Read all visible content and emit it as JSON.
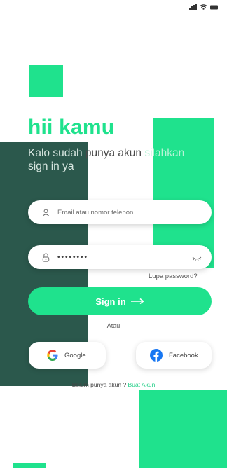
{
  "status_bar": {
    "icons": [
      "signal-icon",
      "wifi-icon",
      "battery-icon"
    ]
  },
  "greeting": "hii kamu",
  "subtitle": {
    "part1": "Kalo sudah ",
    "part2": "punya akun ",
    "part3": "silahkan",
    "line2": "sign in ya"
  },
  "email": {
    "placeholder": "Email atau nomor telepon",
    "value": "",
    "icon": "user-icon"
  },
  "password": {
    "masked": "••••••••",
    "icon": "lock-icon",
    "toggle_icon": "eye-closed-icon"
  },
  "forgot_label": "Lupa password?",
  "signin_label": "Sign in",
  "divider_label": "Atau",
  "social": {
    "google_label": "Google",
    "facebook_label": "Facebook"
  },
  "signup": {
    "prompt": "Belum punya akun ? ",
    "link": "Buat Akun"
  },
  "colors": {
    "accent": "#1fe28d",
    "dark_panel": "#2b584c",
    "link": "#1fcf86"
  }
}
